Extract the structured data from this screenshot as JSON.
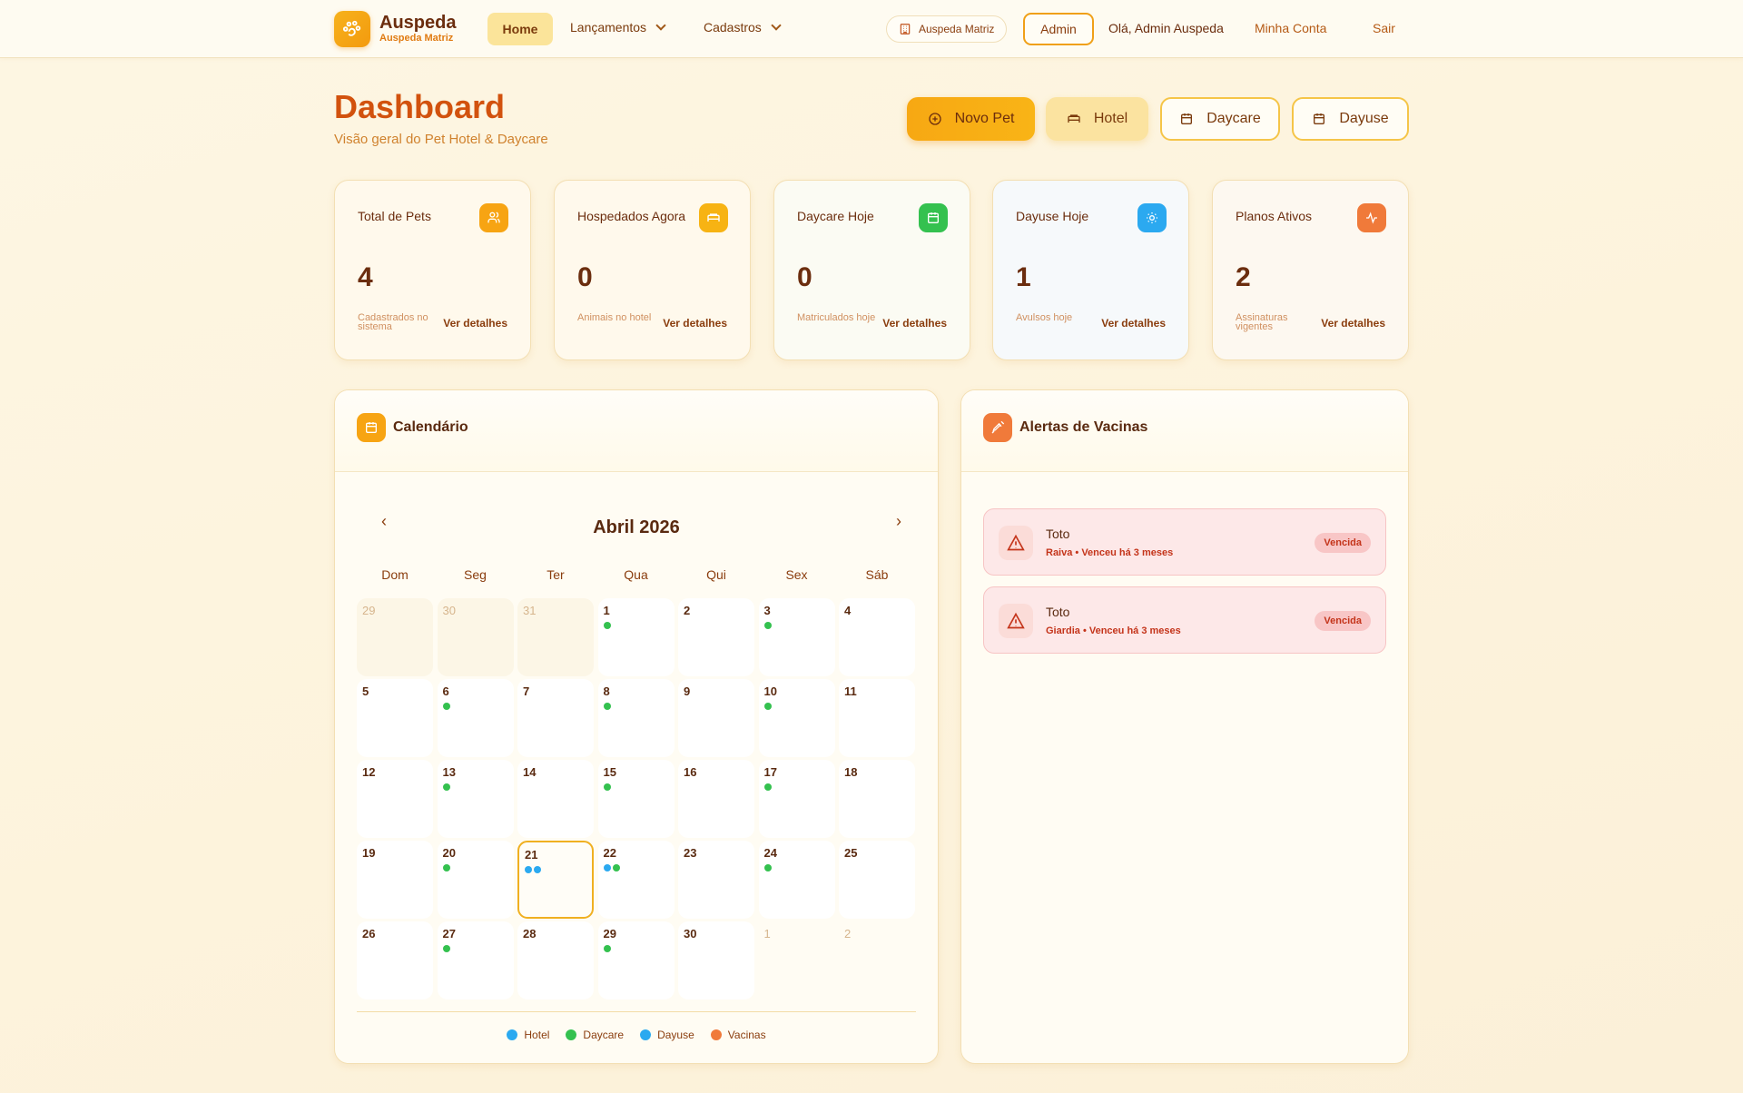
{
  "brand": {
    "name": "Auspeda",
    "sub": "Auspeda Matriz"
  },
  "nav": {
    "home": "Home",
    "lancamentos": "Lançamentos",
    "cadastros": "Cadastros",
    "branch": "Auspeda Matriz",
    "admin": "Admin",
    "greeting": "Olá, Admin Auspeda",
    "account": "Minha Conta",
    "logout": "Sair"
  },
  "header": {
    "title": "Dashboard",
    "subtitle": "Visão geral do Pet Hotel & Daycare",
    "actions": {
      "novo_pet": "Novo Pet",
      "hotel": "Hotel",
      "daycare": "Daycare",
      "dayuse": "Dayuse"
    }
  },
  "stats": [
    {
      "label": "Total de Pets",
      "value": "4",
      "desc": "Cadastrados no sistema",
      "link": "Ver detalhes",
      "icon": "users-icon",
      "color": "#f7a413",
      "bg": "#fff9ec"
    },
    {
      "label": "Hospedados Agora",
      "value": "0",
      "desc": "Animais no hotel",
      "link": "Ver detalhes",
      "icon": "bed-icon",
      "color": "#f7b313",
      "bg": "#fff9ec"
    },
    {
      "label": "Daycare Hoje",
      "value": "0",
      "desc": "Matriculados hoje",
      "link": "Ver detalhes",
      "icon": "calendar-icon",
      "color": "#34c14f",
      "bg": "#fbfbf3"
    },
    {
      "label": "Dayuse Hoje",
      "value": "1",
      "desc": "Avulsos hoje",
      "link": "Ver detalhes",
      "icon": "sun-icon",
      "color": "#2ba9f0",
      "bg": "#f6f9fb"
    },
    {
      "label": "Planos Ativos",
      "value": "2",
      "desc": "Assinaturas vigentes",
      "link": "Ver detalhes",
      "icon": "activity-icon",
      "color": "#f07a3a",
      "bg": "#fdf8f0"
    }
  ],
  "calendar": {
    "title": "Calendário",
    "month": "Abril 2026",
    "weekdays": [
      "Dom",
      "Seg",
      "Ter",
      "Qua",
      "Qui",
      "Sex",
      "Sáb"
    ],
    "colors": {
      "hotel": "#2ba9f0",
      "daycare": "#34c14f",
      "dayuse": "#2ba9f0",
      "vacinas": "#f07a3a"
    },
    "days": [
      {
        "n": "29",
        "state": "muted",
        "dots": []
      },
      {
        "n": "30",
        "state": "muted",
        "dots": []
      },
      {
        "n": "31",
        "state": "muted",
        "dots": []
      },
      {
        "n": "1",
        "state": "",
        "dots": [
          "daycare"
        ]
      },
      {
        "n": "2",
        "state": "",
        "dots": []
      },
      {
        "n": "3",
        "state": "",
        "dots": [
          "daycare"
        ]
      },
      {
        "n": "4",
        "state": "",
        "dots": []
      },
      {
        "n": "5",
        "state": "",
        "dots": []
      },
      {
        "n": "6",
        "state": "",
        "dots": [
          "daycare"
        ]
      },
      {
        "n": "7",
        "state": "",
        "dots": []
      },
      {
        "n": "8",
        "state": "",
        "dots": [
          "daycare"
        ]
      },
      {
        "n": "9",
        "state": "",
        "dots": []
      },
      {
        "n": "10",
        "state": "",
        "dots": [
          "daycare"
        ]
      },
      {
        "n": "11",
        "state": "",
        "dots": []
      },
      {
        "n": "12",
        "state": "",
        "dots": []
      },
      {
        "n": "13",
        "state": "",
        "dots": [
          "daycare"
        ]
      },
      {
        "n": "14",
        "state": "",
        "dots": []
      },
      {
        "n": "15",
        "state": "",
        "dots": [
          "daycare"
        ]
      },
      {
        "n": "16",
        "state": "",
        "dots": []
      },
      {
        "n": "17",
        "state": "",
        "dots": [
          "daycare"
        ]
      },
      {
        "n": "18",
        "state": "",
        "dots": []
      },
      {
        "n": "19",
        "state": "",
        "dots": []
      },
      {
        "n": "20",
        "state": "",
        "dots": [
          "daycare"
        ]
      },
      {
        "n": "21",
        "state": "sel",
        "dots": [
          "hotel",
          "dayuse"
        ]
      },
      {
        "n": "22",
        "state": "",
        "dots": [
          "hotel",
          "daycare"
        ]
      },
      {
        "n": "23",
        "state": "",
        "dots": []
      },
      {
        "n": "24",
        "state": "",
        "dots": [
          "daycare"
        ]
      },
      {
        "n": "25",
        "state": "",
        "dots": []
      },
      {
        "n": "26",
        "state": "",
        "dots": []
      },
      {
        "n": "27",
        "state": "",
        "dots": [
          "daycare"
        ]
      },
      {
        "n": "28",
        "state": "",
        "dots": []
      },
      {
        "n": "29",
        "state": "",
        "dots": [
          "daycare"
        ]
      },
      {
        "n": "30",
        "state": "",
        "dots": []
      },
      {
        "n": "1",
        "state": "out",
        "dots": []
      },
      {
        "n": "2",
        "state": "out",
        "dots": []
      }
    ],
    "legend": [
      {
        "key": "hotel",
        "label": "Hotel"
      },
      {
        "key": "daycare",
        "label": "Daycare"
      },
      {
        "key": "dayuse",
        "label": "Dayuse"
      },
      {
        "key": "vacinas",
        "label": "Vacinas"
      }
    ]
  },
  "alerts": {
    "title": "Alertas de Vacinas",
    "items": [
      {
        "pet": "Toto",
        "info": "Raiva • Venceu há 3 meses",
        "badge": "Vencida"
      },
      {
        "pet": "Toto",
        "info": "Giardia • Venceu há 3 meses",
        "badge": "Vencida"
      }
    ]
  }
}
